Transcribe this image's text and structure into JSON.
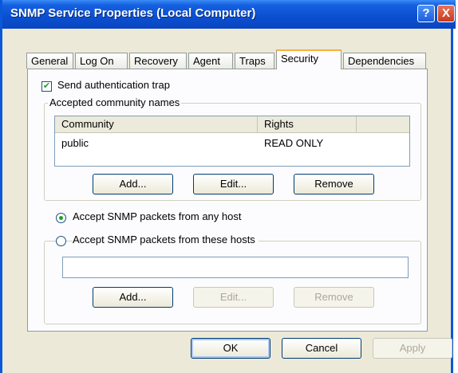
{
  "window": {
    "title": "SNMP Service Properties (Local Computer)",
    "help_label": "?",
    "close_label": "X"
  },
  "tabs": [
    {
      "label": "General"
    },
    {
      "label": "Log On"
    },
    {
      "label": "Recovery"
    },
    {
      "label": "Agent"
    },
    {
      "label": "Traps"
    },
    {
      "label": "Security",
      "active": true
    },
    {
      "label": "Dependencies"
    }
  ],
  "security": {
    "send_auth_trap_label": "Send authentication trap",
    "send_auth_trap_checked": true,
    "community_group_label": "Accepted community names",
    "community_columns": [
      "Community",
      "Rights"
    ],
    "communities": [
      {
        "community": "public",
        "rights": "READ ONLY"
      }
    ],
    "community_buttons": {
      "add": "Add...",
      "edit": "Edit...",
      "remove": "Remove"
    },
    "accept_any_host_label": "Accept SNMP packets from any host",
    "accept_these_hosts_label": "Accept SNMP packets from these hosts",
    "selected_option": "any",
    "hosts_value": "",
    "hosts_buttons": {
      "add": "Add...",
      "edit": "Edit...",
      "remove": "Remove"
    }
  },
  "footer": {
    "ok": "OK",
    "cancel": "Cancel",
    "apply": "Apply"
  }
}
